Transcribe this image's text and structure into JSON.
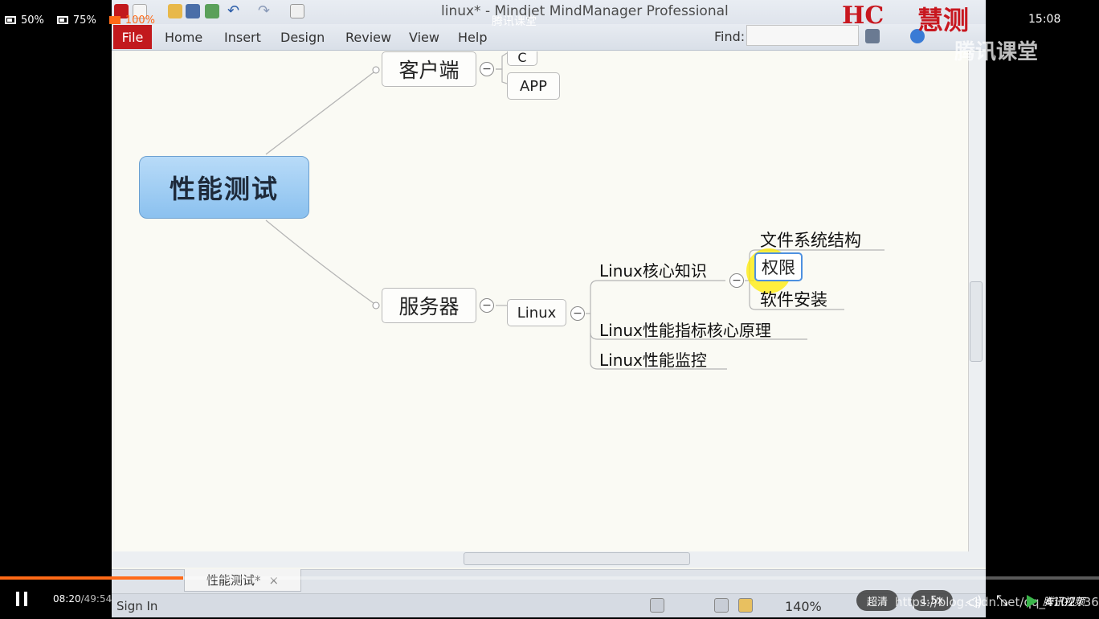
{
  "player": {
    "zoom_options": [
      "50%",
      "75%",
      "100%"
    ],
    "active_zoom": "100%",
    "video_title": "腾讯课堂",
    "clock": "15:08",
    "current_time": "08:20",
    "duration": "/49:54",
    "progress": 0.167,
    "quality": "超清",
    "speed": "1.5x",
    "watermark": "https://blog.csdn.net/qq_41027366",
    "brand": "腾讯视频"
  },
  "watermarks": {
    "logo_hc": "HC",
    "logo_text": "慧测",
    "tencent": "腾讯课堂"
  },
  "app": {
    "window_title": "linux* - Mindjet MindManager Professional",
    "menu": [
      "File",
      "Home",
      "Insert",
      "Design",
      "Review",
      "View",
      "Help"
    ],
    "find_label": "Find:",
    "find_value": "",
    "doc_tab": "性能测试*",
    "doc_tab_close": "×",
    "sign_in": "Sign In",
    "zoom": "140%"
  },
  "mindmap": {
    "central": "性能测试",
    "client": {
      "label": "客户端",
      "children": [
        "C",
        "APP"
      ]
    },
    "server": {
      "label": "服务器",
      "linux": "Linux",
      "topics": [
        "Linux核心知识",
        "Linux性能指标核心原理",
        "Linux性能监控"
      ],
      "core_children": [
        "文件系统结构",
        "权限",
        "软件安装"
      ],
      "selected": "权限"
    },
    "collapse_symbol": "−"
  },
  "colors": {
    "accent": "#ff6a17",
    "file_tab": "#c2191d",
    "central_fill": "#9fcdf3",
    "selection": "#4d90e0",
    "highlight": "#ffeb00"
  }
}
